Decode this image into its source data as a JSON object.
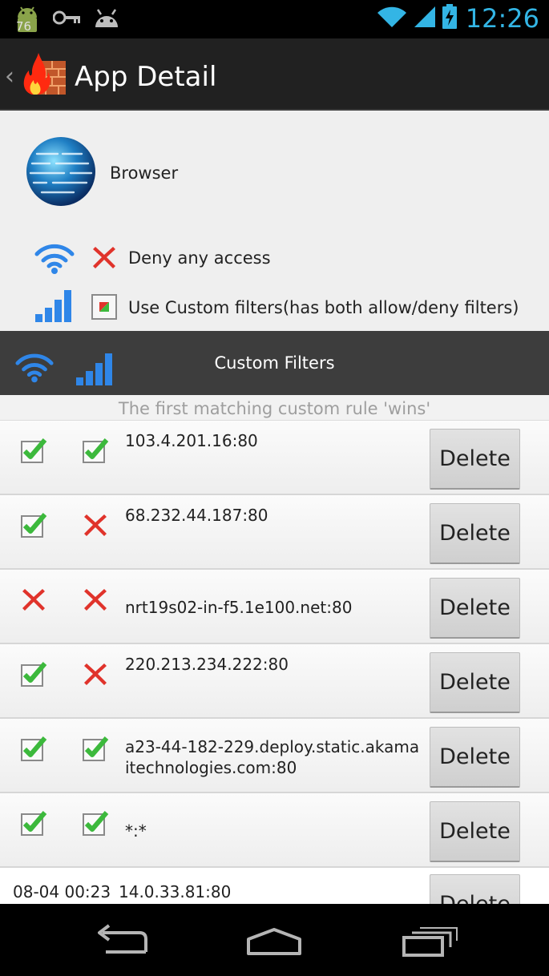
{
  "status_bar": {
    "notification_badge": "76",
    "time": "12:26"
  },
  "action_bar": {
    "title": "App Detail"
  },
  "app": {
    "name": "Browser"
  },
  "options": [
    {
      "label": "Deny any access",
      "state": "deny"
    },
    {
      "label": "Use Custom filters(has both allow/deny filters)",
      "state": "partial"
    }
  ],
  "custom_filters": {
    "title": "Custom Filters",
    "hint": "The first matching custom rule 'wins'"
  },
  "filters": [
    {
      "wifi": "allow",
      "mobile": "allow",
      "address": "103.4.201.16:80",
      "delete_label": "Delete"
    },
    {
      "wifi": "allow",
      "mobile": "deny",
      "address": "68.232.44.187:80",
      "delete_label": "Delete"
    },
    {
      "wifi": "deny",
      "mobile": "deny",
      "address": "nrt19s02-in-f5.1e100.net:80",
      "delete_label": "Delete"
    },
    {
      "wifi": "allow",
      "mobile": "deny",
      "address": "220.213.234.222:80",
      "delete_label": "Delete"
    },
    {
      "wifi": "allow",
      "mobile": "allow",
      "address": "a23-44-182-229.deploy.static.akamaitechnologies.com:80",
      "delete_label": "Delete"
    },
    {
      "wifi": "allow",
      "mobile": "allow",
      "address": "*:*",
      "delete_label": "Delete"
    }
  ],
  "log_entry": {
    "timestamp": "08-04 00:23",
    "address": "14.0.33.81:80",
    "delete_label": "Delete"
  },
  "colors": {
    "accent": "#33b5e5",
    "allow": "#3cb93c",
    "deny": "#e0332b",
    "signal": "#2f86e8"
  }
}
